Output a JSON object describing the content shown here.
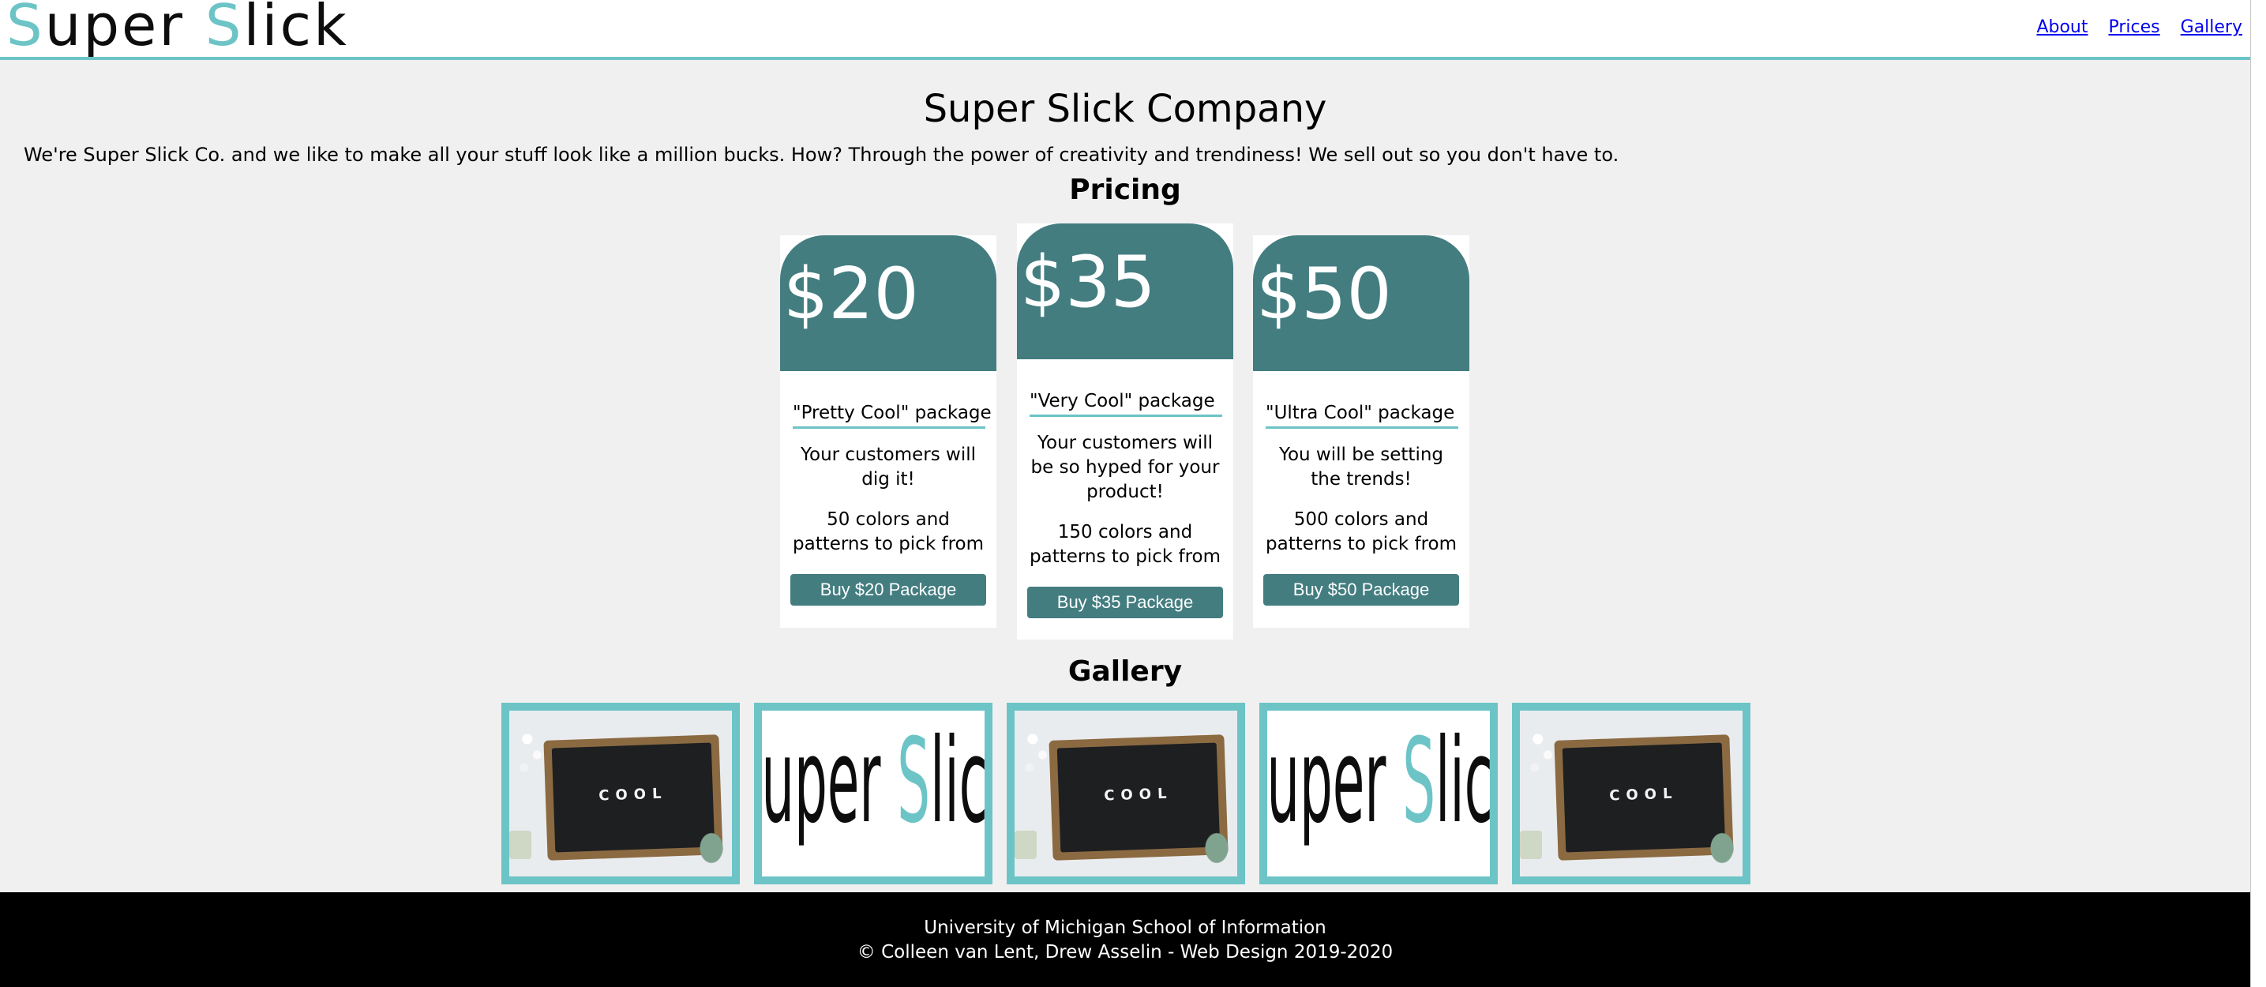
{
  "header": {
    "logo_part1_accent": "S",
    "logo_part1_rest": "uper ",
    "logo_part2_accent": "S",
    "logo_part2_rest": "lick",
    "nav": [
      "About",
      "Prices",
      "Gallery"
    ]
  },
  "main": {
    "title": "Super Slick Company",
    "intro": "We're Super Slick Co. and we like to make all your stuff look like a million bucks. How? Through the power of creativity and trendiness! We sell out so you don't have to.",
    "pricing_heading": "Pricing",
    "gallery_heading": "Gallery"
  },
  "pricing": [
    {
      "price": "$20",
      "package": "\"Pretty Cool\" package",
      "description": "Your customers will dig it!",
      "colors": "50 colors and patterns to pick from",
      "button": "Buy $20 Package"
    },
    {
      "price": "$35",
      "package": "\"Very Cool\" package",
      "description": "Your customers will be so hyped for your product!",
      "colors": "150 colors and patterns to pick from",
      "button": "Buy $35 Package"
    },
    {
      "price": "$50",
      "package": "\"Ultra Cool\" package",
      "description": "You will be setting the trends!",
      "colors": "500 colors and patterns to pick from",
      "button": "Buy $50 Package"
    }
  ],
  "gallery": {
    "board_word": "COOL",
    "logo_text": "Super Slick"
  },
  "footer": {
    "line1": "University of Michigan School of Information",
    "line2": "© Colleen van Lent, Drew Asselin - Web Design 2019-2020"
  },
  "colors": {
    "accent_teal": "#6cc4c7",
    "card_teal": "#437d80",
    "page_bg": "#f0f0f0",
    "footer_bg": "#000000"
  }
}
